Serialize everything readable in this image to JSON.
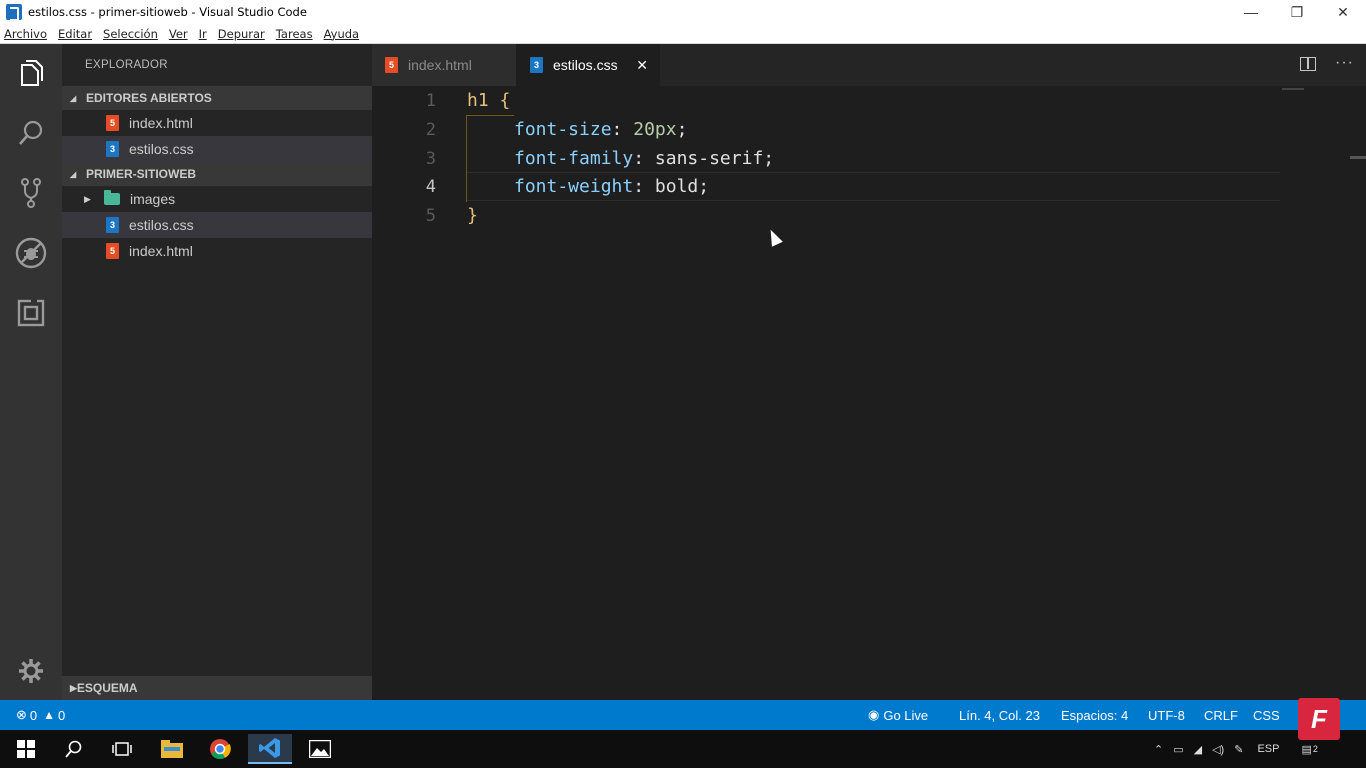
{
  "window": {
    "title": "estilos.css - primer-sitioweb - Visual Studio Code",
    "minimize": "—",
    "maximize": "❐",
    "close": "✕"
  },
  "menu": [
    "Archivo",
    "Editar",
    "Selección",
    "Ver",
    "Ir",
    "Depurar",
    "Tareas",
    "Ayuda"
  ],
  "sidebar": {
    "title": "EXPLORADOR",
    "open_editors": {
      "header": "EDITORES ABIERTOS",
      "items": [
        {
          "label": "index.html",
          "icon": "html-file-icon"
        },
        {
          "label": "estilos.css",
          "icon": "css-file-icon"
        }
      ]
    },
    "project": {
      "header": "PRIMER-SITIOWEB",
      "items": [
        {
          "label": "images",
          "icon": "folder-icon"
        },
        {
          "label": "estilos.css",
          "icon": "css-file-icon"
        },
        {
          "label": "index.html",
          "icon": "html-file-icon"
        }
      ]
    },
    "outline": {
      "header": "ESQUEMA"
    }
  },
  "tabs": [
    {
      "label": "index.html",
      "active": false
    },
    {
      "label": "estilos.css",
      "active": true,
      "close": "✕"
    }
  ],
  "editor": {
    "current_line": 4,
    "lines": [
      {
        "n": "1",
        "sel": "h1",
        "brace": "{"
      },
      {
        "n": "2",
        "prop": "font-size",
        "value": "20px"
      },
      {
        "n": "3",
        "prop": "font-family",
        "value": "sans-serif"
      },
      {
        "n": "4",
        "prop": "font-weight",
        "value": "bold"
      },
      {
        "n": "5",
        "brace": "}"
      }
    ]
  },
  "statusbar": {
    "errors": "0",
    "warnings": "0",
    "go_live": "Go Live",
    "position": "Lín. 4, Col. 23",
    "spaces": "Espacios: 4",
    "encoding": "UTF-8",
    "eol": "CRLF",
    "language": "CSS",
    "notifications": "2"
  },
  "taskbar": {
    "language": "ESP"
  },
  "brand": {
    "letter": "F",
    "color": "#d7263d"
  },
  "colors": {
    "statusbar": "#007acc",
    "activitybar": "#333333",
    "sidebar": "#252526",
    "editor": "#1e1e1e"
  }
}
